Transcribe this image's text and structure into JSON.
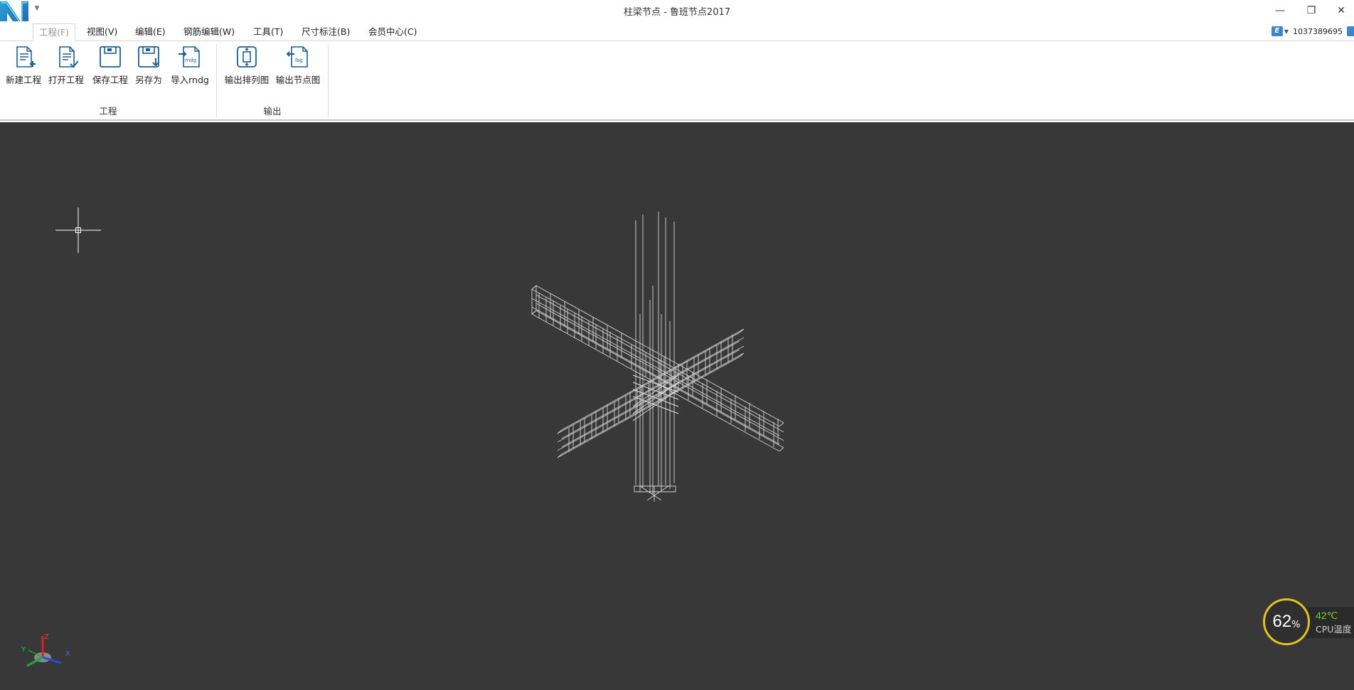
{
  "window": {
    "title": "柱梁节点 - 鲁班节点2017",
    "minimize_glyph": "—",
    "restore_glyph": "❐",
    "close_glyph": "✕",
    "logo_icon": "luban-logo-icon"
  },
  "menu": {
    "tabs": [
      {
        "label": "工程(F)",
        "active": true
      },
      {
        "label": "视图(V)",
        "active": false
      },
      {
        "label": "编辑(E)",
        "active": false
      },
      {
        "label": "钢筋编辑(W)",
        "active": false
      },
      {
        "label": "工具(T)",
        "active": false
      },
      {
        "label": "尺寸标注(B)",
        "active": false
      },
      {
        "label": "会员中心(C)",
        "active": false
      }
    ],
    "user_id": "1037389695",
    "user_icon_letter": "E"
  },
  "ribbon": {
    "groups": [
      {
        "label": "工程",
        "buttons": [
          {
            "label": "新建工程",
            "icon": "new-document-icon"
          },
          {
            "label": "打开工程",
            "icon": "open-document-icon"
          },
          {
            "label": "保存工程",
            "icon": "save-icon"
          },
          {
            "label": "另存为",
            "icon": "save-as-icon"
          },
          {
            "label": "导入rndg",
            "icon": "import-rndg-icon"
          }
        ]
      },
      {
        "label": "输出",
        "buttons": [
          {
            "label": "输出排列图",
            "icon": "export-layout-icon"
          },
          {
            "label": "输出节点图",
            "icon": "export-node-icon"
          }
        ]
      }
    ]
  },
  "viewport": {
    "background": "#383838",
    "axes": {
      "x": "X",
      "y": "Y",
      "z": "Z"
    }
  },
  "cpu_widget": {
    "usage": "62",
    "usage_unit": "%",
    "temperature": "42℃",
    "label": "CPU温度",
    "ring_color": "#e1c21e",
    "temp_color": "#6ad32b"
  }
}
